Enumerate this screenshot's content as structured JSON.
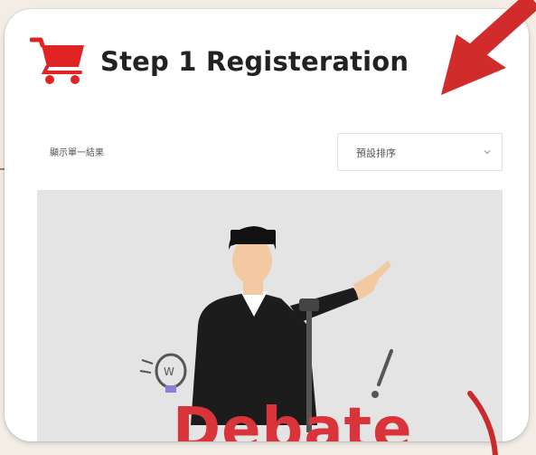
{
  "header": {
    "icon": "shopping-cart-icon",
    "title": "Step 1 Registeration"
  },
  "toolbar": {
    "result_count": "顯示單一結果",
    "sort_select": {
      "selected": "預設排序"
    }
  },
  "product": {
    "image_text": "Debate",
    "image_subject": "speaker-at-podium illustration"
  },
  "colors": {
    "accent_red": "#e02424",
    "annotation_red": "#d12b2b",
    "page_background": "#f3ede6",
    "divider_brown": "#b07b52"
  }
}
